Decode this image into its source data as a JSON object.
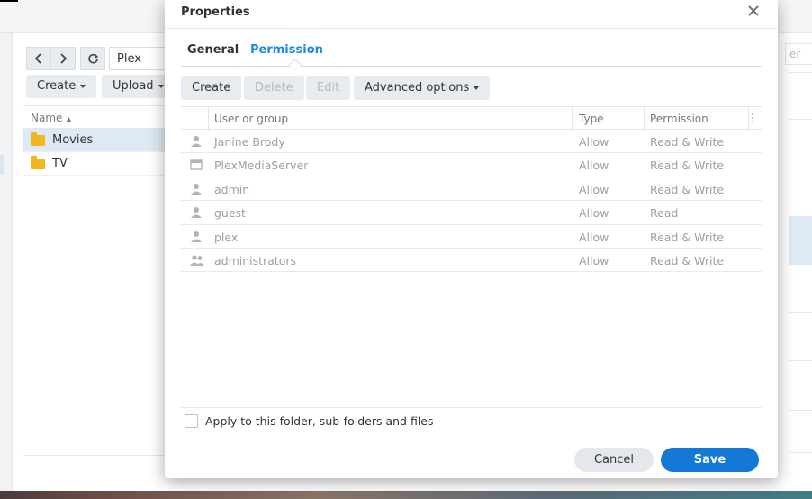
{
  "background": {
    "path": "Plex",
    "create_label": "Create",
    "upload_label": "Upload",
    "name_header": "Name",
    "files": [
      {
        "name": "Movies",
        "selected": true
      },
      {
        "name": "TV",
        "selected": false
      }
    ],
    "right_input_fragment": "er"
  },
  "dialog": {
    "title": "Properties",
    "tabs": [
      {
        "label": "General",
        "active": false
      },
      {
        "label": "Permission",
        "active": true
      }
    ],
    "toolbar": {
      "create": "Create",
      "delete": "Delete",
      "edit": "Edit",
      "advanced": "Advanced options"
    },
    "table": {
      "headers": {
        "user": "User or group",
        "type": "Type",
        "permission": "Permission"
      },
      "rows": [
        {
          "icon": "user-icon",
          "name": "Janine Brody",
          "type": "Allow",
          "permission": "Read & Write"
        },
        {
          "icon": "app-icon",
          "name": "PlexMediaServer",
          "type": "Allow",
          "permission": "Read & Write"
        },
        {
          "icon": "user-icon",
          "name": "admin",
          "type": "Allow",
          "permission": "Read & Write"
        },
        {
          "icon": "user-icon",
          "name": "guest",
          "type": "Allow",
          "permission": "Read"
        },
        {
          "icon": "user-icon",
          "name": "plex",
          "type": "Allow",
          "permission": "Read & Write"
        },
        {
          "icon": "group-icon",
          "name": "administrators",
          "type": "Allow",
          "permission": "Read & Write"
        }
      ]
    },
    "apply_label": "Apply to this folder, sub-folders and files",
    "cancel": "Cancel",
    "save": "Save"
  },
  "colors": {
    "accent": "#1479d6",
    "tab_active": "#1e88e5",
    "folder": "#f2b71e"
  }
}
